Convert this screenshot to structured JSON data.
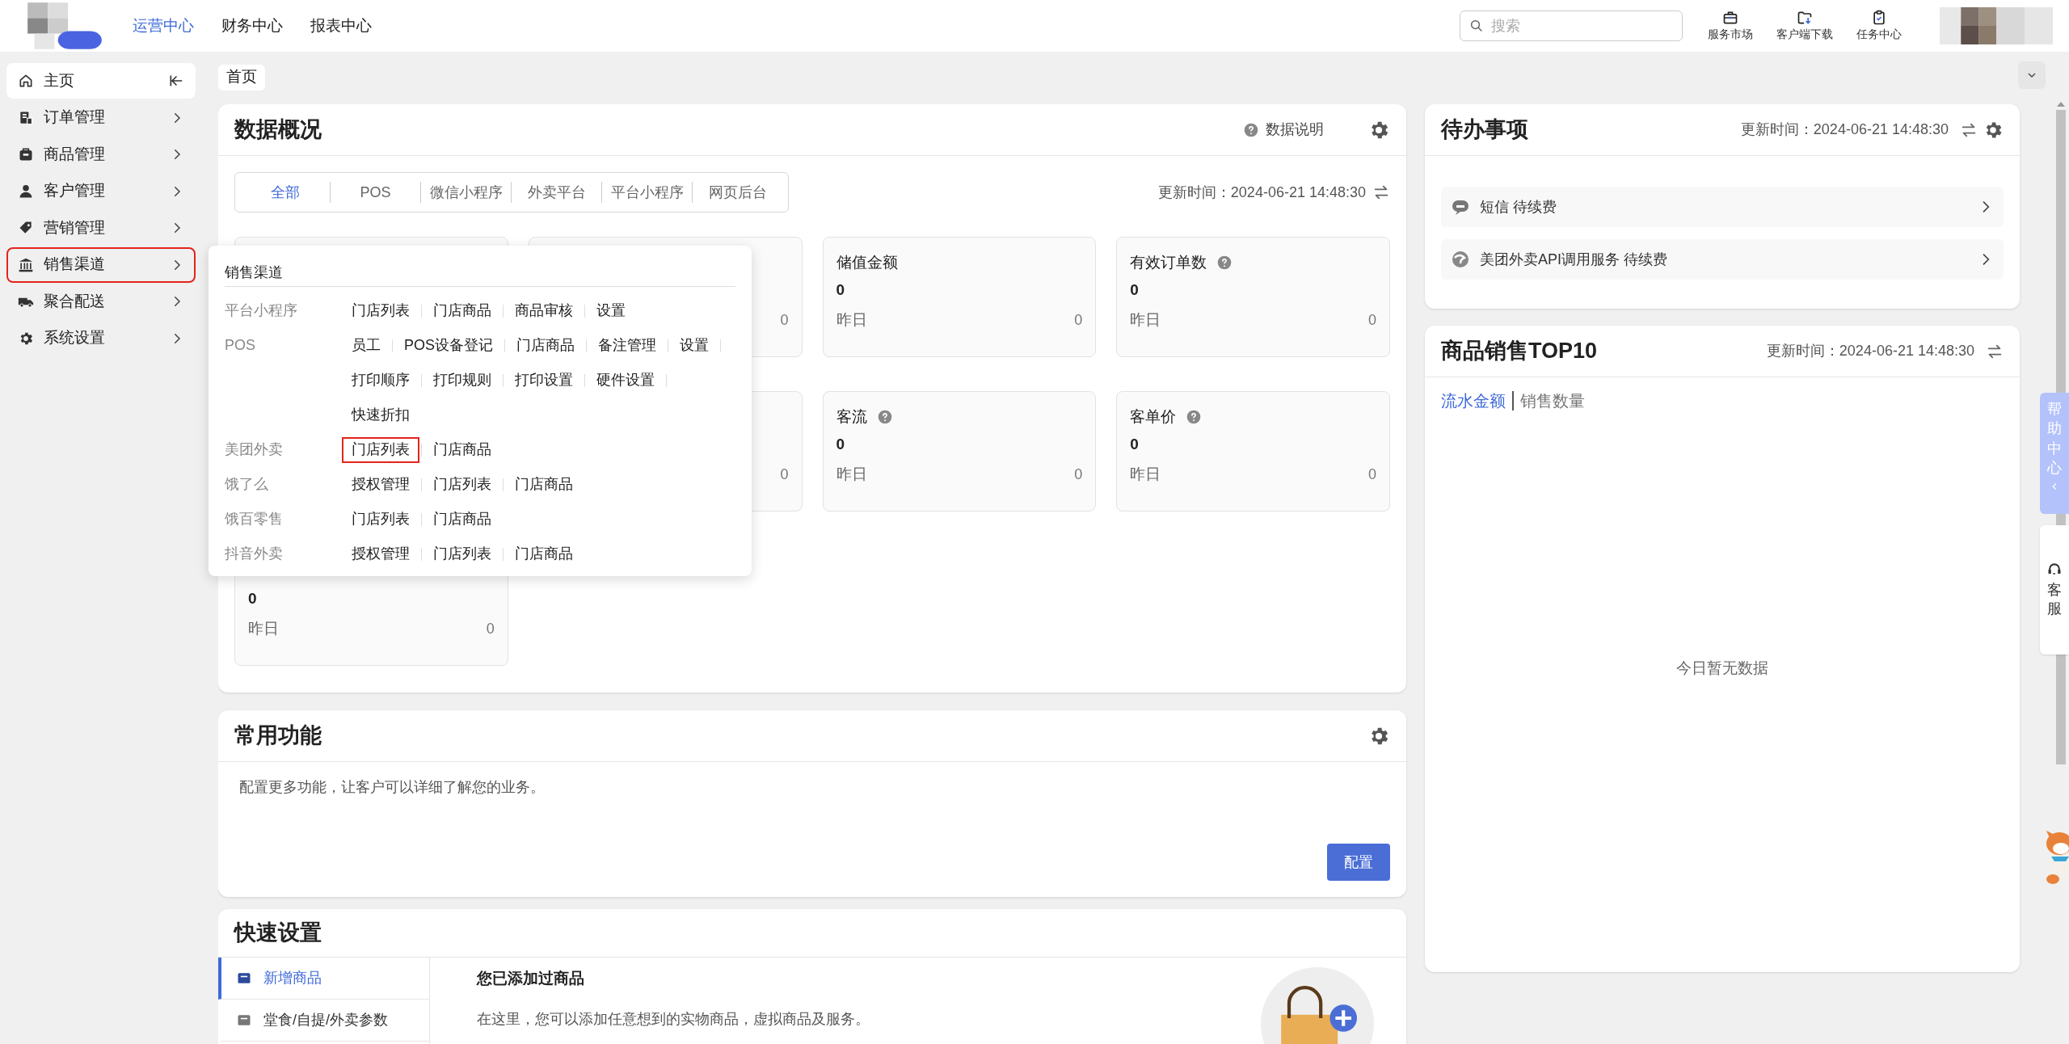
{
  "header": {
    "nav": [
      {
        "label": "运营中心",
        "selected": true
      },
      {
        "label": "财务中心",
        "selected": false
      },
      {
        "label": "报表中心",
        "selected": false
      }
    ],
    "search": {
      "placeholder": "搜索"
    },
    "tools": [
      {
        "label": "服务市场"
      },
      {
        "label": "客户端下载"
      },
      {
        "label": "任务中心"
      }
    ]
  },
  "sidebar": {
    "items": [
      {
        "label": "主页",
        "kind": "home",
        "selected": true,
        "highlighted": false
      },
      {
        "label": "订单管理",
        "kind": "menu",
        "selected": false,
        "highlighted": false
      },
      {
        "label": "商品管理",
        "kind": "menu",
        "selected": false,
        "highlighted": false
      },
      {
        "label": "客户管理",
        "kind": "menu",
        "selected": false,
        "highlighted": false
      },
      {
        "label": "营销管理",
        "kind": "menu",
        "selected": false,
        "highlighted": false
      },
      {
        "label": "销售渠道",
        "kind": "menu",
        "selected": false,
        "highlighted": true
      },
      {
        "label": "聚合配送",
        "kind": "menu",
        "selected": false,
        "highlighted": false
      },
      {
        "label": "系统设置",
        "kind": "menu",
        "selected": false,
        "highlighted": false
      }
    ]
  },
  "page_tabs": [
    {
      "label": "首页"
    }
  ],
  "data_overview": {
    "title": "数据概况",
    "help_link": "数据说明",
    "updated": "更新时间：2024-06-21 14:48:30",
    "filters": [
      {
        "label": "全部",
        "selected": true
      },
      {
        "label": "POS",
        "selected": false
      },
      {
        "label": "微信小程序",
        "selected": false
      },
      {
        "label": "外卖平台",
        "selected": false
      },
      {
        "label": "平台小程序",
        "selected": false
      },
      {
        "label": "网页后台",
        "selected": false
      }
    ],
    "cards": [
      {
        "kind": "covered"
      },
      {
        "kind": "metric",
        "yesterday_value": "0"
      },
      {
        "kind": "metric",
        "label": "储值金额",
        "value": "0",
        "yesterday_label": "昨日",
        "yesterday_value": "0"
      },
      {
        "kind": "metric",
        "label": "有效订单数",
        "help": true,
        "value": "0",
        "yesterday_label": "昨日",
        "yesterday_value": "0"
      },
      {
        "kind": "metric",
        "yesterday_value": "0"
      },
      {
        "kind": "metric",
        "label": "客流",
        "help": true,
        "value": "0",
        "yesterday_label": "昨日",
        "yesterday_value": "0"
      },
      {
        "kind": "metric",
        "label": "客单价",
        "help": true,
        "value": "0",
        "yesterday_label": "昨日",
        "yesterday_value": "0"
      },
      {
        "kind": "metric",
        "value": "0",
        "yesterday_label": "昨日",
        "yesterday_value": "0"
      }
    ]
  },
  "sales_channel_menu": {
    "title": "销售渠道",
    "rows": [
      {
        "label": "平台小程序",
        "lines": [
          [
            {
              "label": "门店列表",
              "highlighted": false
            },
            {
              "label": "门店商品",
              "highlighted": false
            },
            {
              "label": "商品审核",
              "highlighted": false
            },
            {
              "label": "设置",
              "highlighted": false
            }
          ]
        ]
      },
      {
        "label": "POS",
        "lines": [
          [
            {
              "label": "员工",
              "highlighted": false
            },
            {
              "label": "POS设备登记",
              "highlighted": false
            },
            {
              "label": "门店商品",
              "highlighted": false
            },
            {
              "label": "备注管理",
              "highlighted": false
            },
            {
              "label": "设置",
              "highlighted": false
            }
          ],
          [
            {
              "label": "打印顺序",
              "highlighted": false
            },
            {
              "label": "打印规则",
              "highlighted": false
            },
            {
              "label": "打印设置",
              "highlighted": false
            },
            {
              "label": "硬件设置",
              "highlighted": false
            }
          ],
          [
            {
              "label": "快速折扣",
              "highlighted": false
            }
          ]
        ]
      },
      {
        "label": "美团外卖",
        "lines": [
          [
            {
              "label": "门店列表",
              "highlighted": true
            },
            {
              "label": "门店商品",
              "highlighted": false
            }
          ]
        ]
      },
      {
        "label": "饿了么",
        "lines": [
          [
            {
              "label": "授权管理",
              "highlighted": false
            },
            {
              "label": "门店列表",
              "highlighted": false
            },
            {
              "label": "门店商品",
              "highlighted": false
            }
          ]
        ]
      },
      {
        "label": "饿百零售",
        "lines": [
          [
            {
              "label": "门店列表",
              "highlighted": false
            },
            {
              "label": "门店商品",
              "highlighted": false
            }
          ]
        ]
      },
      {
        "label": "抖音外卖",
        "lines": [
          [
            {
              "label": "授权管理",
              "highlighted": false
            },
            {
              "label": "门店列表",
              "highlighted": false
            },
            {
              "label": "门店商品",
              "highlighted": false
            }
          ]
        ]
      }
    ]
  },
  "common_functions": {
    "title": "常用功能",
    "description": "配置更多功能，让客户可以详细了解您的业务。",
    "button": "配置"
  },
  "quick_setup": {
    "title": "快速设置",
    "tabs": [
      {
        "label": "新增商品",
        "selected": true
      },
      {
        "label": "堂食/自提/外卖参数",
        "selected": false
      }
    ],
    "heading": "您已添加过商品",
    "description": "在这里，您可以添加任意想到的实物商品，虚拟商品及服务。"
  },
  "todo": {
    "title": "待办事项",
    "updated": "更新时间：2024-06-21 14:48:30",
    "items": [
      {
        "label": "短信 待续费"
      },
      {
        "label": "美团外卖API调用服务 待续费"
      }
    ]
  },
  "top_sales": {
    "title": "商品销售TOP10",
    "updated": "更新时间：2024-06-21 14:48:30",
    "toggles": [
      {
        "label": "流水金额",
        "selected": true
      },
      {
        "label": "销售数量",
        "selected": false
      }
    ],
    "empty": "今日暂无数据"
  },
  "side_tabs": {
    "help": "帮助中心",
    "service": "客服"
  }
}
